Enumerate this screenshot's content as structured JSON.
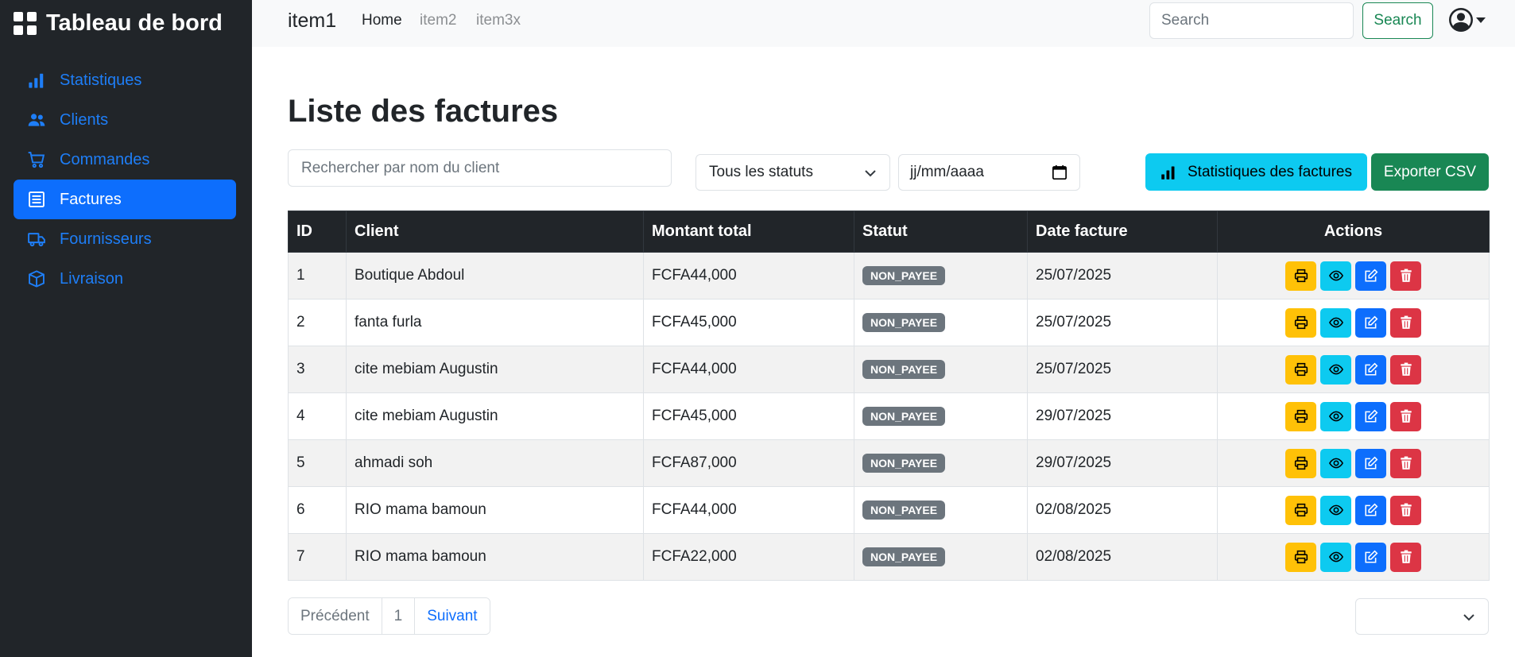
{
  "sidebar": {
    "brand": "Tableau de bord",
    "items": [
      {
        "label": "Statistiques",
        "icon": "bar-chart-icon"
      },
      {
        "label": "Clients",
        "icon": "people-icon"
      },
      {
        "label": "Commandes",
        "icon": "cart-icon"
      },
      {
        "label": "Factures",
        "icon": "receipt-icon",
        "active": true
      },
      {
        "label": "Fournisseurs",
        "icon": "truck-icon"
      },
      {
        "label": "Livraison",
        "icon": "box-icon"
      }
    ]
  },
  "topbar": {
    "brand": "item1",
    "links": [
      "Home",
      "item2",
      "item3x"
    ],
    "search_placeholder": "Search",
    "search_button": "Search"
  },
  "main": {
    "title": "Liste des factures",
    "filter_placeholder": "Rechercher par nom du client",
    "status_select": "Tous les statuts",
    "date_placeholder": "jj/mm/aaaa",
    "stats_button": "Statistiques des factures",
    "export_button": "Exporter CSV"
  },
  "table": {
    "headers": [
      "ID",
      "Client",
      "Montant total",
      "Statut",
      "Date facture",
      "Actions"
    ],
    "rows": [
      {
        "id": "1",
        "client": "Boutique Abdoul",
        "montant": "FCFA44,000",
        "statut": "NON_PAYEE",
        "date": "25/07/2025"
      },
      {
        "id": "2",
        "client": "fanta furla",
        "montant": "FCFA45,000",
        "statut": "NON_PAYEE",
        "date": "25/07/2025"
      },
      {
        "id": "3",
        "client": "cite mebiam Augustin",
        "montant": "FCFA44,000",
        "statut": "NON_PAYEE",
        "date": "25/07/2025"
      },
      {
        "id": "4",
        "client": "cite mebiam Augustin",
        "montant": "FCFA45,000",
        "statut": "NON_PAYEE",
        "date": "29/07/2025"
      },
      {
        "id": "5",
        "client": "ahmadi soh",
        "montant": "FCFA87,000",
        "statut": "NON_PAYEE",
        "date": "29/07/2025"
      },
      {
        "id": "6",
        "client": "RIO mama bamoun",
        "montant": "FCFA44,000",
        "statut": "NON_PAYEE",
        "date": "02/08/2025"
      },
      {
        "id": "7",
        "client": "RIO mama bamoun",
        "montant": "FCFA22,000",
        "statut": "NON_PAYEE",
        "date": "02/08/2025"
      }
    ]
  },
  "pagination": {
    "prev": "Précédent",
    "page": "1",
    "next": "Suivant",
    "page_size": ""
  },
  "colors": {
    "sidebar_bg": "#212529",
    "accent": "#0d6efd",
    "success": "#198754",
    "info": "#0dcaf0",
    "warning": "#ffc107",
    "danger": "#dc3545",
    "badge": "#6c757d"
  }
}
